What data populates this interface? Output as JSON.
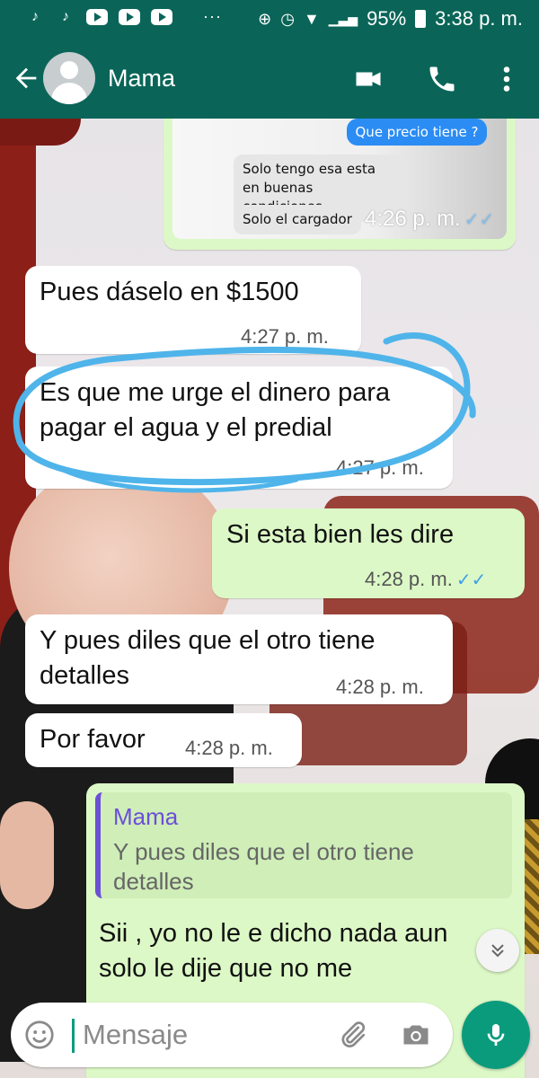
{
  "status_bar": {
    "notification_icons": [
      "tiktok-icon",
      "tiktok-icon",
      "youtube-icon",
      "youtube-icon",
      "youtube-icon"
    ],
    "overflow": "···",
    "battery": "95%",
    "time": "3:38 p. m."
  },
  "header": {
    "contact_name": "Mama"
  },
  "shared_screenshot": {
    "sent_pill": "Que precio tiene ?",
    "reply_1": "Solo tengo esa esta en buenas condiciones",
    "reply_2": "Solo el cargador",
    "time": "4:26 p. m."
  },
  "messages": [
    {
      "direction": "in",
      "text": "Pues dáselo en $1500",
      "time": "4:27 p. m."
    },
    {
      "direction": "in",
      "text": "Es que me urge el dinero para pagar el agua y el predial",
      "time": "4:27 p. m."
    },
    {
      "direction": "out",
      "text": "Si esta bien les dire",
      "time": "4:28 p. m."
    },
    {
      "direction": "in",
      "text": "Y pues diles que el otro tiene detalles",
      "time": "4:28 p. m."
    },
    {
      "direction": "in",
      "text": "Por favor",
      "time": "4:28 p. m."
    }
  ],
  "reply_message": {
    "quote_author": "Mama",
    "quote_text": "Y pues diles que el otro tiene detalles",
    "text": "Sii , yo no le e dicho nada aun solo le dije que no me"
  },
  "composer": {
    "placeholder": "Mensaje"
  },
  "colors": {
    "header": "#0a6558",
    "outgoing_bubble": "#dcf8c6",
    "incoming_bubble": "#ffffff",
    "accent": "#0a9b7d",
    "read_ticks": "#3ea0e6",
    "highlight_stroke": "#4fb4ea",
    "quote_author": "#6c4fd7"
  }
}
